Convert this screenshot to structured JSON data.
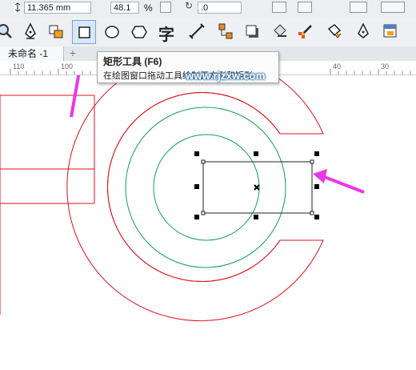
{
  "property_bar": {
    "size_value": "11.365 mm",
    "scale_value": "48.1",
    "scale_unit": "%",
    "rotation_value": ".0"
  },
  "toolbox": {
    "tools": [
      {
        "name": "zoom-tool",
        "icon": "magnifier-icon"
      },
      {
        "name": "freehand-tool",
        "icon": "pen-nib-icon"
      },
      {
        "name": "smart-fill-tool",
        "icon": "fill-bucket-icon"
      },
      {
        "name": "rectangle-tool",
        "icon": "rectangle-icon",
        "active": true
      },
      {
        "name": "ellipse-tool",
        "icon": "ellipse-icon"
      },
      {
        "name": "polygon-tool",
        "icon": "hexagon-icon"
      },
      {
        "name": "text-tool",
        "icon": "text-icon"
      },
      {
        "name": "dimension-tool",
        "icon": "dimension-icon"
      },
      {
        "name": "connector-tool",
        "icon": "connector-icon"
      },
      {
        "name": "shadow-tool",
        "icon": "shadow-icon"
      },
      {
        "name": "transparency-tool",
        "icon": "transparency-icon"
      },
      {
        "name": "eyedropper-tool",
        "icon": "eyedropper-icon"
      },
      {
        "name": "interactive-fill-tool",
        "icon": "paint-bucket-icon"
      },
      {
        "name": "outline-pen-tool",
        "icon": "outline-pen-icon"
      },
      {
        "name": "color-palette-tool",
        "icon": "palette-icon"
      }
    ],
    "text_tool_glyph": "字"
  },
  "tabs": {
    "document_tab": "未命名 -1",
    "add_tab": "+"
  },
  "ruler": {
    "labels": [
      "110",
      "100",
      "40",
      "30"
    ]
  },
  "tooltip": {
    "title": "矩形工具 (F6)",
    "description": "在绘图窗口拖动工具绘制正方形和矩形"
  },
  "watermark": "www.rjzxw.com",
  "colors": {
    "outline_red": "#e0101c",
    "outline_green": "#10a050",
    "annotation_arrow": "#e838e8",
    "selected_tool_bg": "#d7e7f8"
  }
}
